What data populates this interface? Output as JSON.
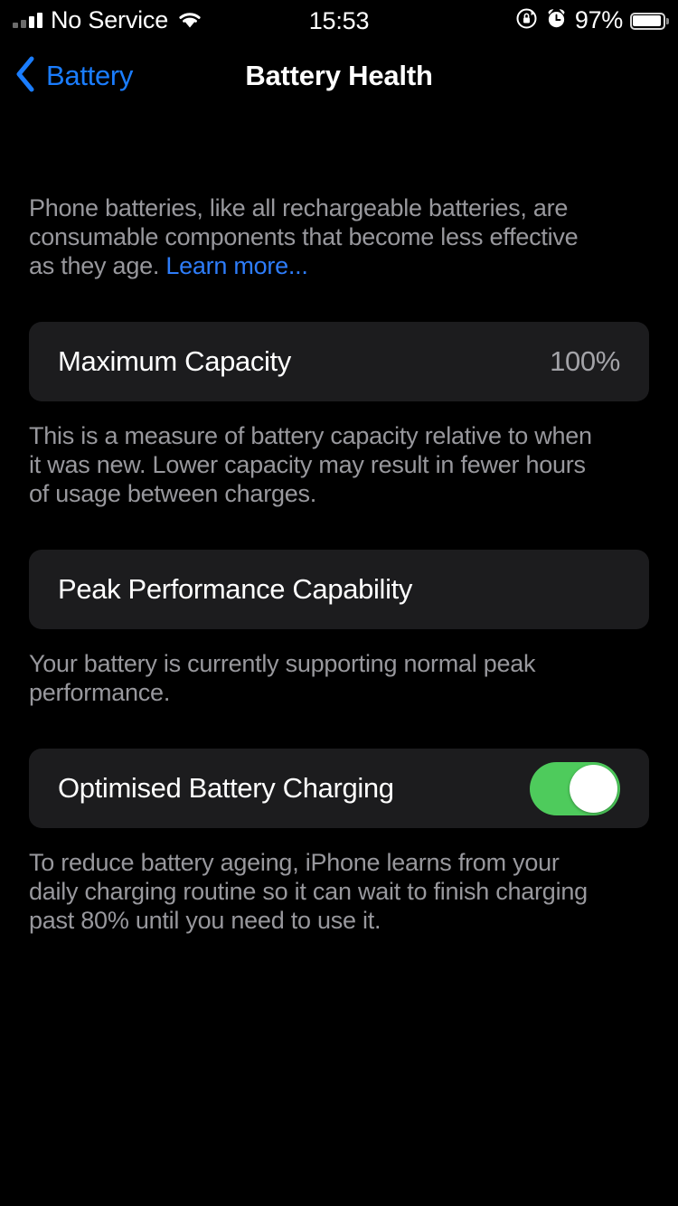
{
  "status_bar": {
    "carrier": "No Service",
    "wifi_icon": "wifi-icon",
    "signal_icon": "cellular-signal-icon",
    "time": "15:53",
    "rotation_lock_icon": "rotation-lock-icon",
    "alarm_icon": "alarm-clock-icon",
    "battery_percent": "97%",
    "battery_icon": "battery-full-icon"
  },
  "nav": {
    "back_label": "Battery",
    "back_icon": "chevron-left-icon",
    "title": "Battery Health"
  },
  "intro": {
    "text": "Phone batteries, like all rechargeable batteries, are consumable components that become less effective as they age. ",
    "link_label": "Learn more..."
  },
  "maximum_capacity": {
    "label": "Maximum Capacity",
    "value": "100%",
    "footnote": "This is a measure of battery capacity relative to when it was new. Lower capacity may result in fewer hours of usage between charges."
  },
  "peak_performance": {
    "label": "Peak Performance Capability",
    "footnote": "Your battery is currently supporting normal peak performance."
  },
  "optimised_charging": {
    "label": "Optimised Battery Charging",
    "toggle_state": "on",
    "footnote": "To reduce battery ageing, iPhone learns from your daily charging routine so it can wait to finish charging past 80% until you need to use it."
  },
  "colors": {
    "background": "#000000",
    "card": "#1c1c1e",
    "accent_blue": "#1a7dff",
    "link_blue": "#2e7dfa",
    "toggle_on_green": "#4ecb5c",
    "secondary_text": "#98989d"
  }
}
